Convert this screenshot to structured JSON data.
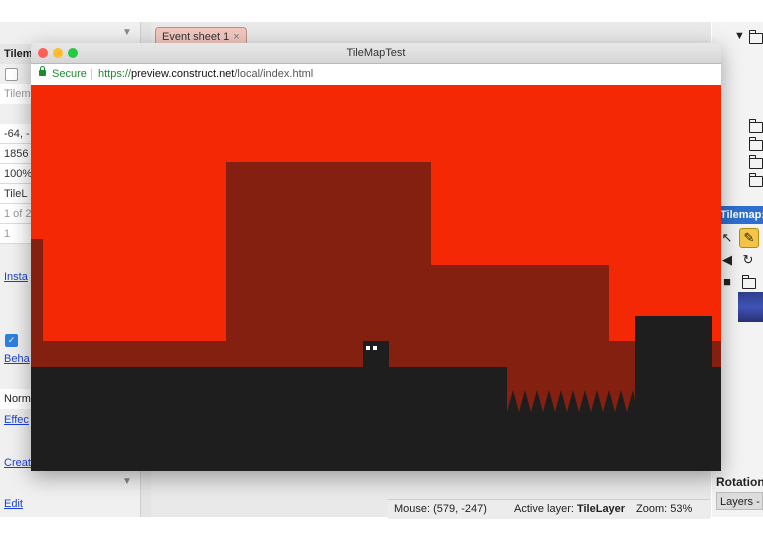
{
  "left_panel": {
    "header": "Tilem",
    "field_gray": "Tilem",
    "coords": "-64, -",
    "size": "1856",
    "percent": "100%",
    "layer": "TileL",
    "paging": "1 of 2",
    "one": "1",
    "instance_link": "Insta",
    "behaviors_link": "Beha",
    "normal": "Norm",
    "effects_link": "Effec",
    "create_link": "Creat",
    "edit_link": "Edit"
  },
  "tab": {
    "label": "Event sheet 1",
    "close": "×"
  },
  "browser": {
    "title": "TileMapTest",
    "secure_label": "Secure",
    "url_scheme": "https://",
    "url_host": "preview.construct.net",
    "url_path": "/local/index.html"
  },
  "right_panel": {
    "tilemap_title": "Tilemap: T",
    "rotation_label": "Rotation",
    "layers_tab": "Layers -"
  },
  "status_bar": {
    "mouse": "Mouse: (579, -247)",
    "active_layer_label": "Active layer: ",
    "active_layer_value": "TileLayer",
    "zoom": "Zoom: 53%"
  },
  "colors": {
    "sky": "#f52805",
    "background_buildings": "#84200f",
    "ground": "#1e1e1e",
    "accent_tab": "#f2c7c0",
    "traffic_red": "#fe5f57",
    "traffic_yellow": "#febc2e",
    "traffic_green": "#28c840"
  },
  "icons": {
    "traffic_lights": [
      "close-dot",
      "minimize-dot",
      "maximize-dot"
    ],
    "tools": [
      "pointer-icon",
      "pencil-icon",
      "eraser-icon",
      "rotate-icon",
      "save-icon",
      "folder-icon"
    ]
  }
}
